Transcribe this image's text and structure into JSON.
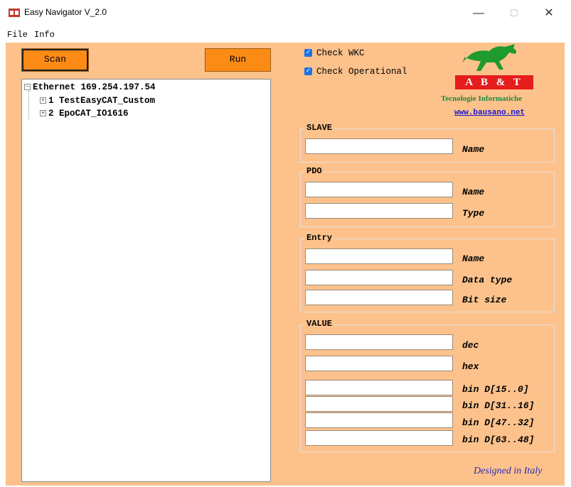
{
  "window": {
    "title": "Easy Navigator V_2.0",
    "controls": {
      "minimize": "—",
      "maximize": "☐",
      "close": "✕"
    }
  },
  "menu": {
    "items": [
      "File",
      "Info"
    ]
  },
  "toolbar": {
    "scan_label": "Scan",
    "run_label": "Run"
  },
  "tree": {
    "root": "Ethernet 169.254.197.54",
    "children": [
      "1 TestEasyCAT_Custom",
      "2 EpoCAT_IO1616"
    ]
  },
  "options": {
    "check_wkc": {
      "label": "Check WKC",
      "checked": true
    },
    "check_operational": {
      "label": "Check Operational",
      "checked": true
    }
  },
  "logo": {
    "brand": "A B & T",
    "subtitle": "Tecnologie Informatiche",
    "link": "www.bausano.net"
  },
  "slave": {
    "title": "SLAVE",
    "fields": [
      {
        "label": "Name",
        "value": ""
      }
    ]
  },
  "pdo": {
    "title": "PDO",
    "fields": [
      {
        "label": "Name",
        "value": ""
      },
      {
        "label": "Type",
        "value": ""
      }
    ]
  },
  "entry": {
    "title": "Entry",
    "fields": [
      {
        "label": "Name",
        "value": ""
      },
      {
        "label": "Data type",
        "value": ""
      },
      {
        "label": "Bit size",
        "value": ""
      }
    ]
  },
  "value": {
    "title": "VALUE",
    "fields": [
      {
        "label": "dec",
        "value": ""
      },
      {
        "label": "hex",
        "value": ""
      },
      {
        "label": "bin D[15..0]",
        "value": ""
      },
      {
        "label": "bin D[31..16]",
        "value": ""
      },
      {
        "label": "bin D[47..32]",
        "value": ""
      },
      {
        "label": "bin D[63..48]",
        "value": ""
      }
    ]
  },
  "footer": {
    "designed": "Designed in Italy"
  },
  "colors": {
    "panel_bg": "#fdc28c",
    "button_bg": "#fc8b16",
    "checkbox": "#1a73e8",
    "logo_red": "#e51d1d",
    "logo_green": "#1a8a3a",
    "link_blue": "#1414d0"
  }
}
